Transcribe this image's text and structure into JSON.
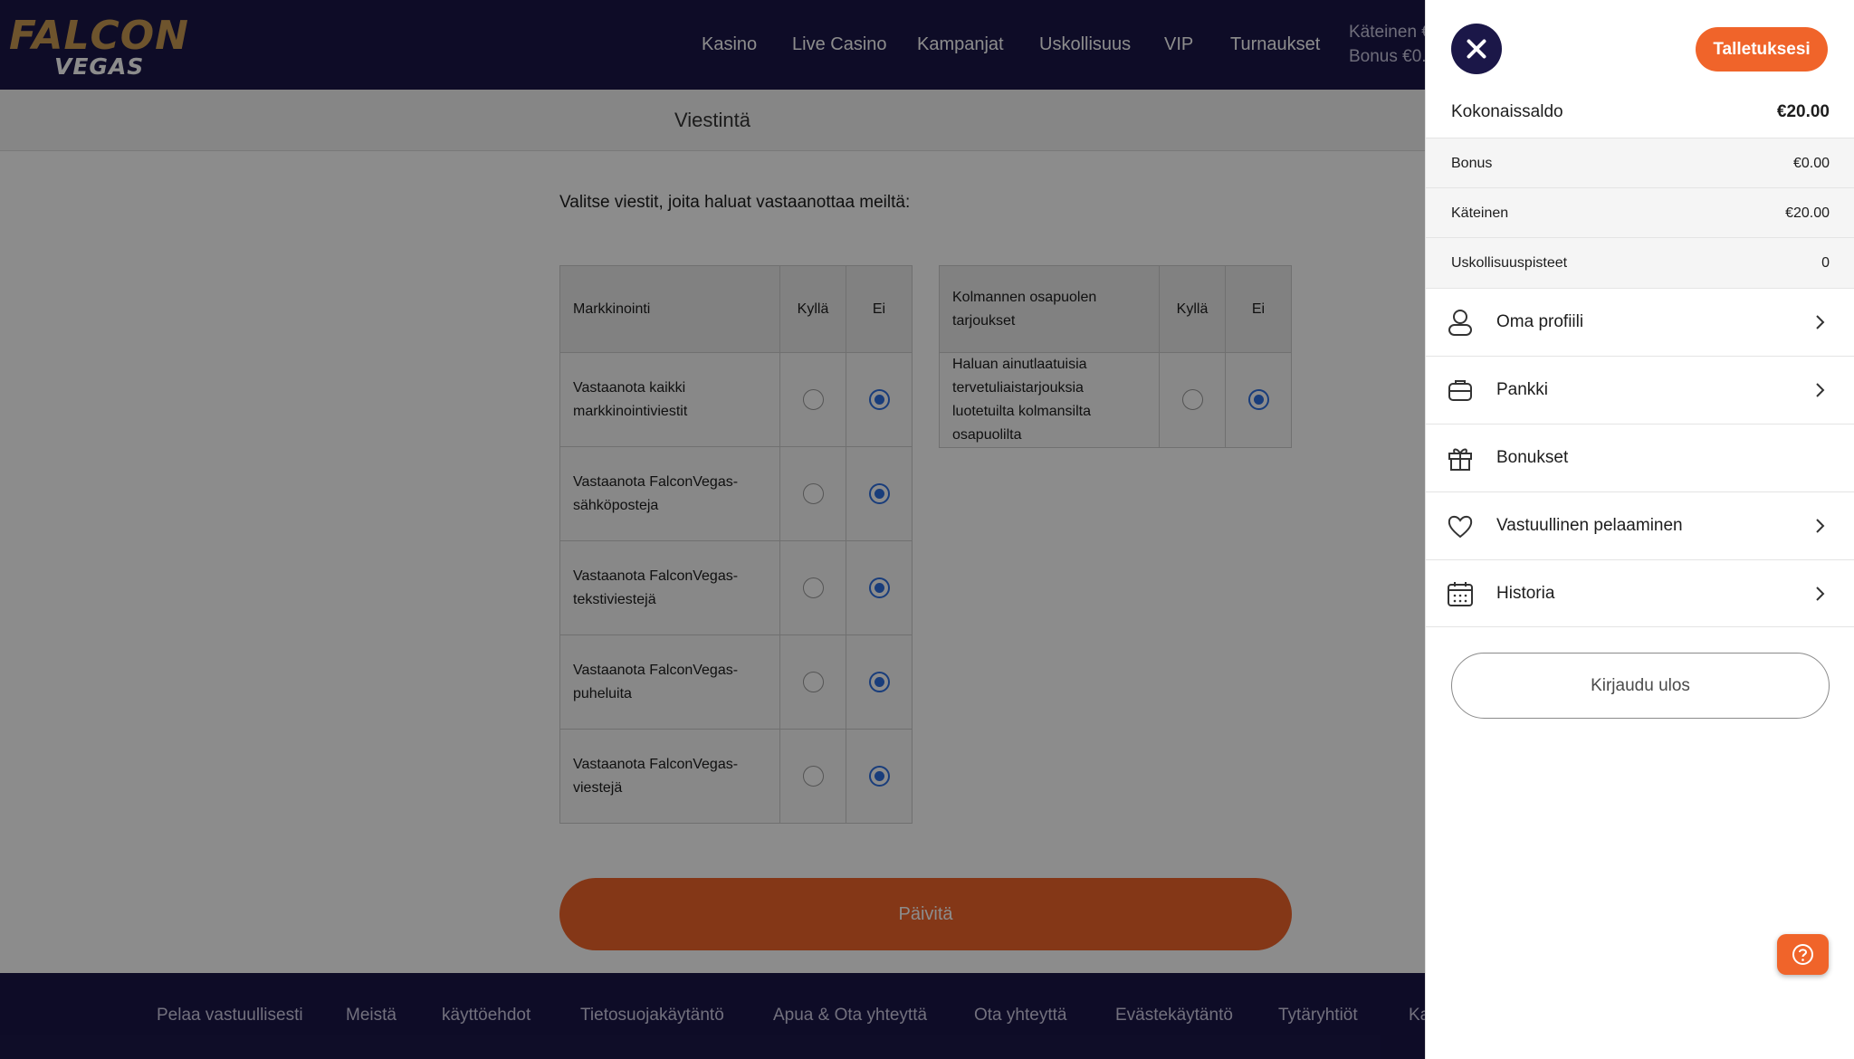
{
  "header": {
    "logo_top": "FALCON",
    "logo_bottom": "VEGAS",
    "nav": [
      "Kasino",
      "Live Casino",
      "Kampanjat",
      "Uskollisuus",
      "VIP",
      "Turnaukset"
    ],
    "cash_label": "Käteinen €",
    "bonus_label": "Bonus €0."
  },
  "subheader": {
    "title": "Viestintä"
  },
  "main": {
    "intro": "Valitse viestit, joita haluat vastaanottaa meiltä:",
    "marketing": {
      "header": "Markkinointi",
      "yes": "Kyllä",
      "no": "Ei",
      "rows": [
        {
          "label": "Vastaanota kaikki markkinointiviestit",
          "selected": "Ei"
        },
        {
          "label": "Vastaanota FalconVegas-sähköposteja",
          "selected": "Ei"
        },
        {
          "label": "Vastaanota FalconVegas-tekstiviestejä",
          "selected": "Ei"
        },
        {
          "label": "Vastaanota FalconVegas-puheluita",
          "selected": "Ei"
        },
        {
          "label": "Vastaanota FalconVegas-viestejä",
          "selected": "Ei"
        }
      ]
    },
    "third_party": {
      "header": "Kolmannen osapuolen tarjoukset",
      "yes": "Kyllä",
      "no": "Ei",
      "rows": [
        {
          "label": "Haluan ainutlaatuisia tervetuliaistarjouksia luotetuilta kolmansilta osapuolilta",
          "selected": "Ei"
        }
      ]
    },
    "update_button": "Päivitä"
  },
  "footer": {
    "links": [
      "Pelaa vastuullisesti",
      "Meistä",
      "käyttöehdot",
      "Tietosuojakäytäntö",
      "Apua & Ota yhteyttä",
      "Ota yhteyttä",
      "Evästekäytäntö",
      "Tytäryhtiöt",
      "Ka"
    ]
  },
  "panel": {
    "deposit_button": "Talletuksesi",
    "total_label": "Kokonaissaldo",
    "total_value": "€20.00",
    "balances": [
      {
        "label": "Bonus",
        "value": "€0.00"
      },
      {
        "label": "Käteinen",
        "value": "€20.00"
      },
      {
        "label": "Uskollisuuspisteet",
        "value": "0"
      }
    ],
    "menu": [
      {
        "label": "Oma profiili",
        "icon": "user-icon",
        "chevron": true
      },
      {
        "label": "Pankki",
        "icon": "wallet-icon",
        "chevron": true
      },
      {
        "label": "Bonukset",
        "icon": "gift-icon",
        "chevron": false
      },
      {
        "label": "Vastuullinen pelaaminen",
        "icon": "heart-icon",
        "chevron": true
      },
      {
        "label": "Historia",
        "icon": "calendar-icon",
        "chevron": true
      }
    ],
    "logout_button": "Kirjaudu ulos"
  },
  "colors": {
    "brand_navy": "#1b1748",
    "accent_orange": "#f0642a",
    "radio_blue": "#2f6fe0",
    "logo_gold": "#c89a52"
  }
}
